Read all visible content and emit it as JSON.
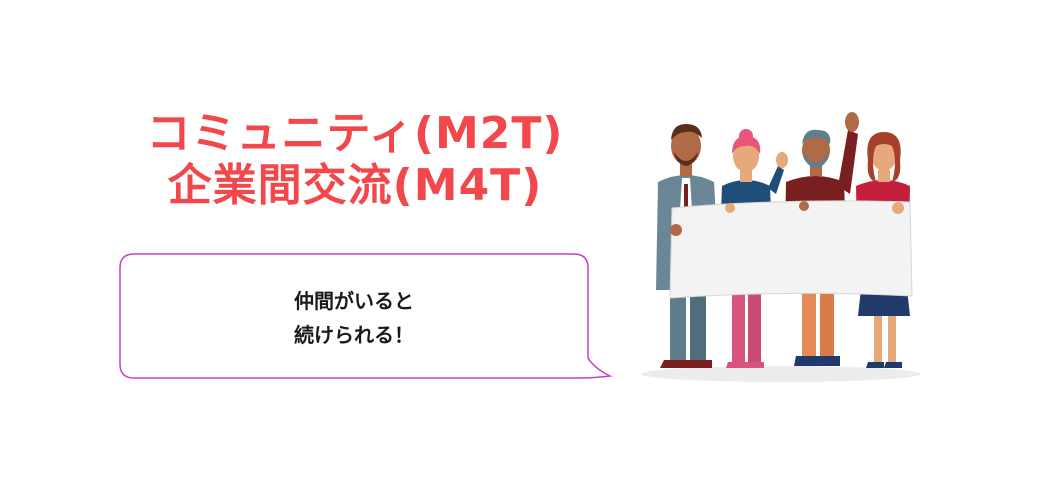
{
  "heading": {
    "line1": "コミュニティ(M2T)",
    "line2": "企業間交流(M4T)",
    "color": "#f2474b"
  },
  "bubble": {
    "line1": "仲間がいると",
    "line2": "続けられる！",
    "border_color": "#c83ec8"
  },
  "illustration": {
    "subject": "group-holding-banner-illustration"
  }
}
